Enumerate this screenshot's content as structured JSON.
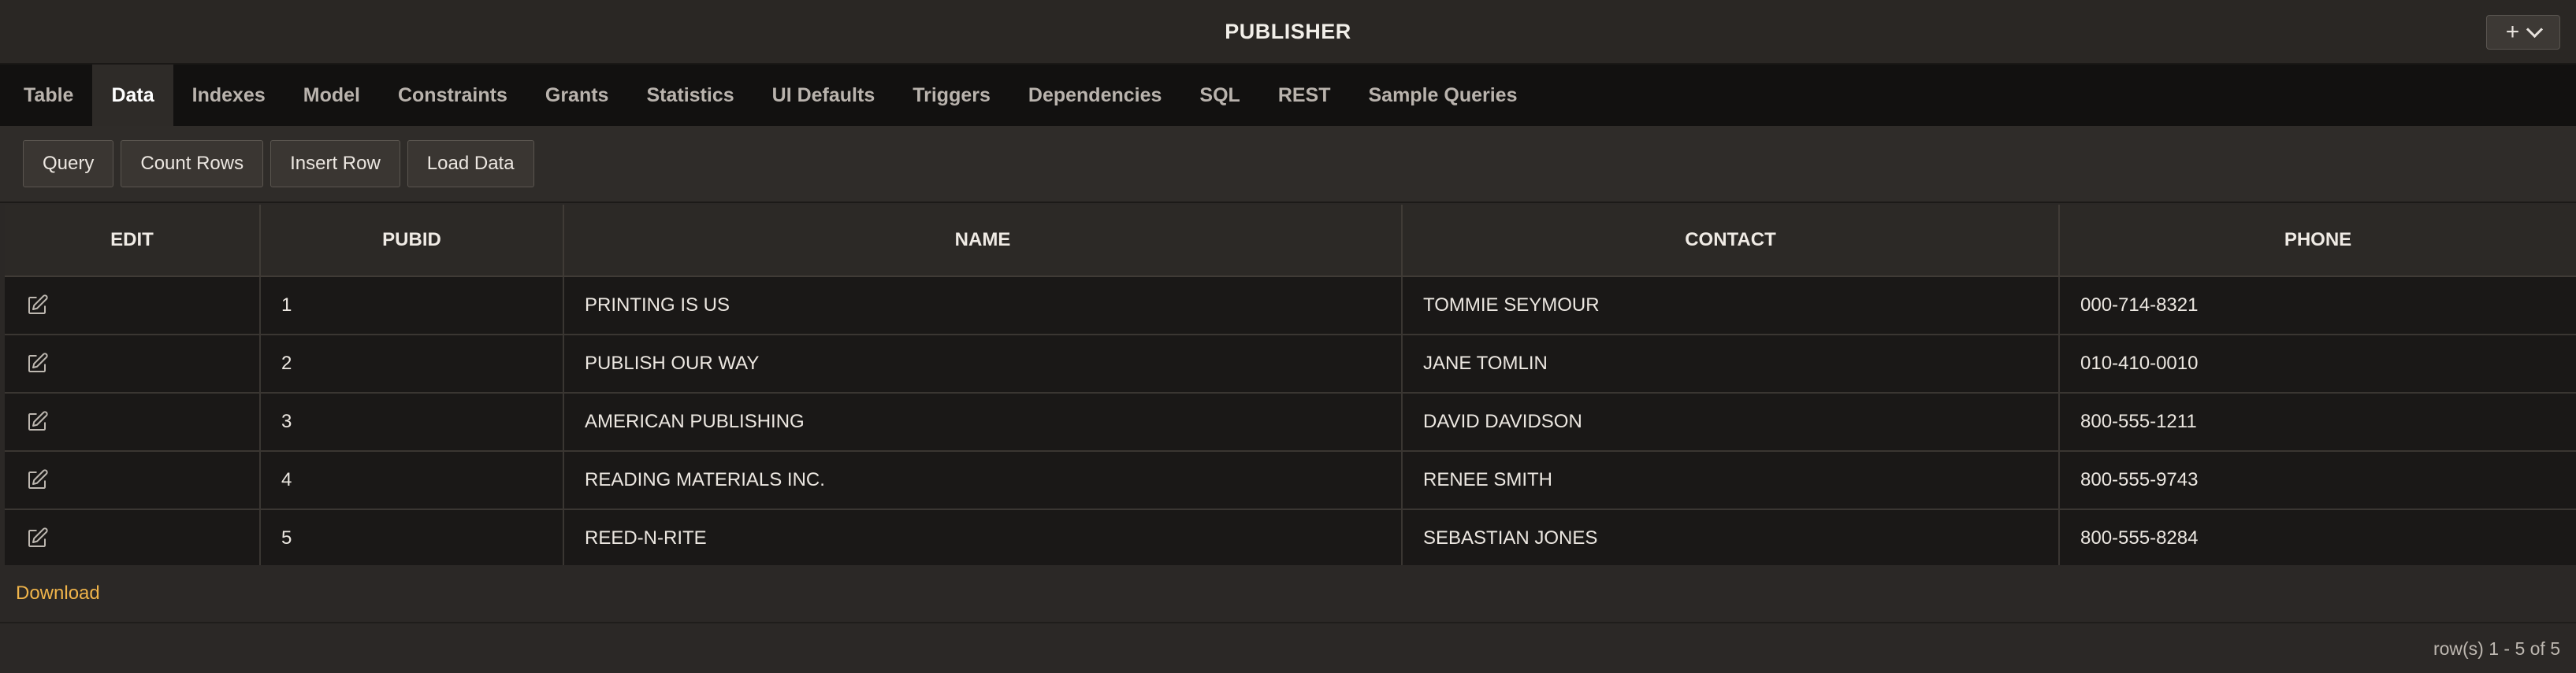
{
  "header": {
    "title": "PUBLISHER",
    "add_icon": "plus-icon",
    "menu_icon": "chevron-down-icon"
  },
  "tabs": [
    {
      "label": "Table"
    },
    {
      "label": "Data",
      "active": true
    },
    {
      "label": "Indexes"
    },
    {
      "label": "Model"
    },
    {
      "label": "Constraints"
    },
    {
      "label": "Grants"
    },
    {
      "label": "Statistics"
    },
    {
      "label": "UI Defaults"
    },
    {
      "label": "Triggers"
    },
    {
      "label": "Dependencies"
    },
    {
      "label": "SQL"
    },
    {
      "label": "REST"
    },
    {
      "label": "Sample Queries"
    }
  ],
  "toolbar": {
    "query_label": "Query",
    "count_rows_label": "Count Rows",
    "insert_row_label": "Insert Row",
    "load_data_label": "Load Data"
  },
  "table": {
    "columns": [
      "EDIT",
      "PUBID",
      "NAME",
      "CONTACT",
      "PHONE"
    ],
    "edit_icon": "edit-icon",
    "rows": [
      {
        "pubid": "1",
        "name": "PRINTING IS US",
        "contact": "TOMMIE SEYMOUR",
        "phone": "000-714-8321"
      },
      {
        "pubid": "2",
        "name": "PUBLISH OUR WAY",
        "contact": "JANE TOMLIN",
        "phone": "010-410-0010"
      },
      {
        "pubid": "3",
        "name": "AMERICAN PUBLISHING",
        "contact": "DAVID DAVIDSON",
        "phone": "800-555-1211"
      },
      {
        "pubid": "4",
        "name": "READING MATERIALS INC.",
        "contact": "RENEE SMITH",
        "phone": "800-555-9743"
      },
      {
        "pubid": "5",
        "name": "REED-N-RITE",
        "contact": "SEBASTIAN JONES",
        "phone": "800-555-8284"
      }
    ]
  },
  "footer": {
    "download_label": "Download",
    "row_status": "row(s) 1 - 5 of 5"
  },
  "colors": {
    "accent_link": "#f0b44a",
    "background": "#2b2826",
    "tab_bar": "#121110"
  }
}
